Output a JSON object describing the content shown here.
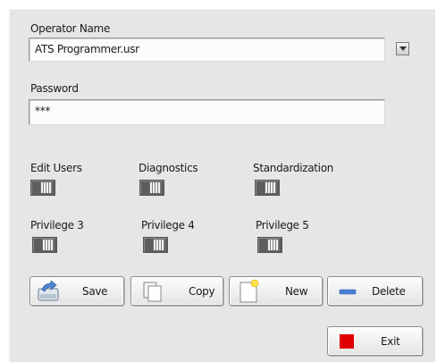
{
  "operator": {
    "label": "Operator Name",
    "value": "ATS Programmer.usr"
  },
  "password": {
    "label": "Password",
    "value": "***"
  },
  "privileges": [
    {
      "label": "Edit Users"
    },
    {
      "label": "Diagnostics"
    },
    {
      "label": "Standardization"
    },
    {
      "label": "Privilege 3"
    },
    {
      "label": "Privilege 4"
    },
    {
      "label": "Privilege 5"
    }
  ],
  "buttons": {
    "save": "Save",
    "copy": "Copy",
    "new": "New",
    "delete": "Delete",
    "exit": "Exit"
  },
  "colors": {
    "exit_icon": "#e00000",
    "delete_icon": "#4a7fd6",
    "save_icon": "#5b8fd4"
  }
}
